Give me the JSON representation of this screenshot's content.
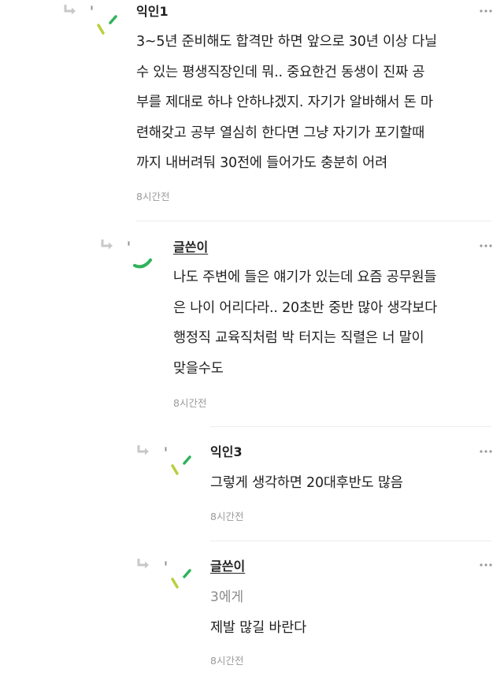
{
  "colors": {
    "avatar_green": "#2fb35a",
    "avatar_lime": "#b9cf3d",
    "arrow_gray": "#c8c8c8"
  },
  "comments": [
    {
      "author": "익인1",
      "is_op": false,
      "body": "3~5년 준비해도 합격만 하면 앞으로 30년 이상 다닐\n수 있는 평생직장인데 뭐.. 중요한건 동생이 진짜 공\n부를 제대로 하냐 안하냐겠지. 자기가 알바해서 돈 마\n련해갖고 공부 열심히 한다면 그냥 자기가 포기할때\n까지 내버려둬 30전에 들어가도 충분히 어려",
      "time": "8시간전",
      "icons": [
        "reply-arrow-icon",
        "more-options-icon"
      ]
    },
    {
      "author": "글쓴이",
      "is_op": true,
      "body": "나도 주변에 들은 얘기가 있는데 요즘 공무원들\n은 나이 어리다라.. 20초반 중반 많아 생각보다\n행정직 교육직처럼 박 터지는 직렬은 너 말이\n맞을수도",
      "time": "8시간전"
    },
    {
      "author": "익인3",
      "is_op": false,
      "body": "그렇게 생각하면 20대후반도 많음",
      "time": "8시간전"
    },
    {
      "author": "글쓴이",
      "is_op": true,
      "mention": "3에게",
      "body": "제발 많길 바란다",
      "time": "8시간전"
    }
  ]
}
